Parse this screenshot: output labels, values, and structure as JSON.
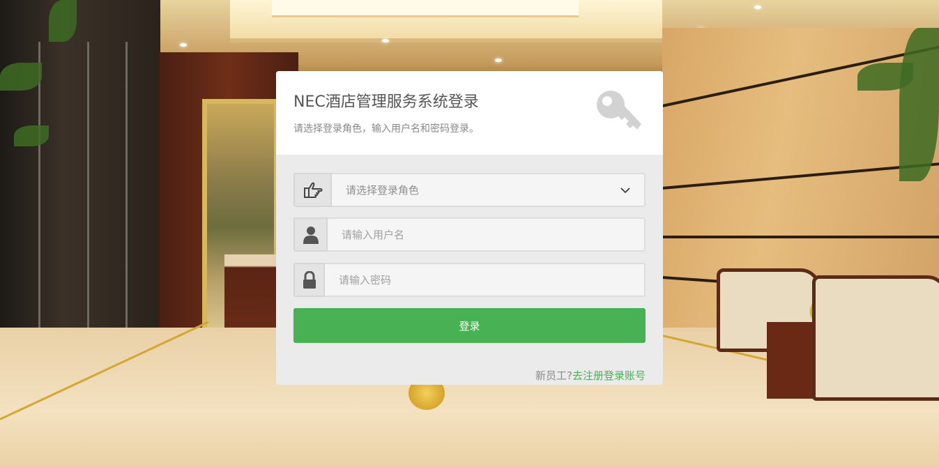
{
  "login": {
    "title": "NEC酒店管理服务系统登录",
    "subtitle": "请选择登录角色，输入用户名和密码登录。",
    "role_select": {
      "selected": "请选择登录角色"
    },
    "username": {
      "placeholder": "请输入用户名",
      "value": ""
    },
    "password": {
      "placeholder": "请输入密码",
      "value": ""
    },
    "submit_label": "登录",
    "register_prompt": "新员工?",
    "register_link": "去注册登录账号"
  },
  "icons": {
    "header": "key-icon",
    "role": "hand-pointing-icon",
    "username": "user-icon",
    "password": "lock-icon",
    "dropdown": "chevron-down-icon"
  },
  "colors": {
    "accent": "#47b153",
    "panel_background": "#ebebeb",
    "header_background": "#ffffff",
    "title_text": "#555555",
    "muted_text": "#888888"
  }
}
